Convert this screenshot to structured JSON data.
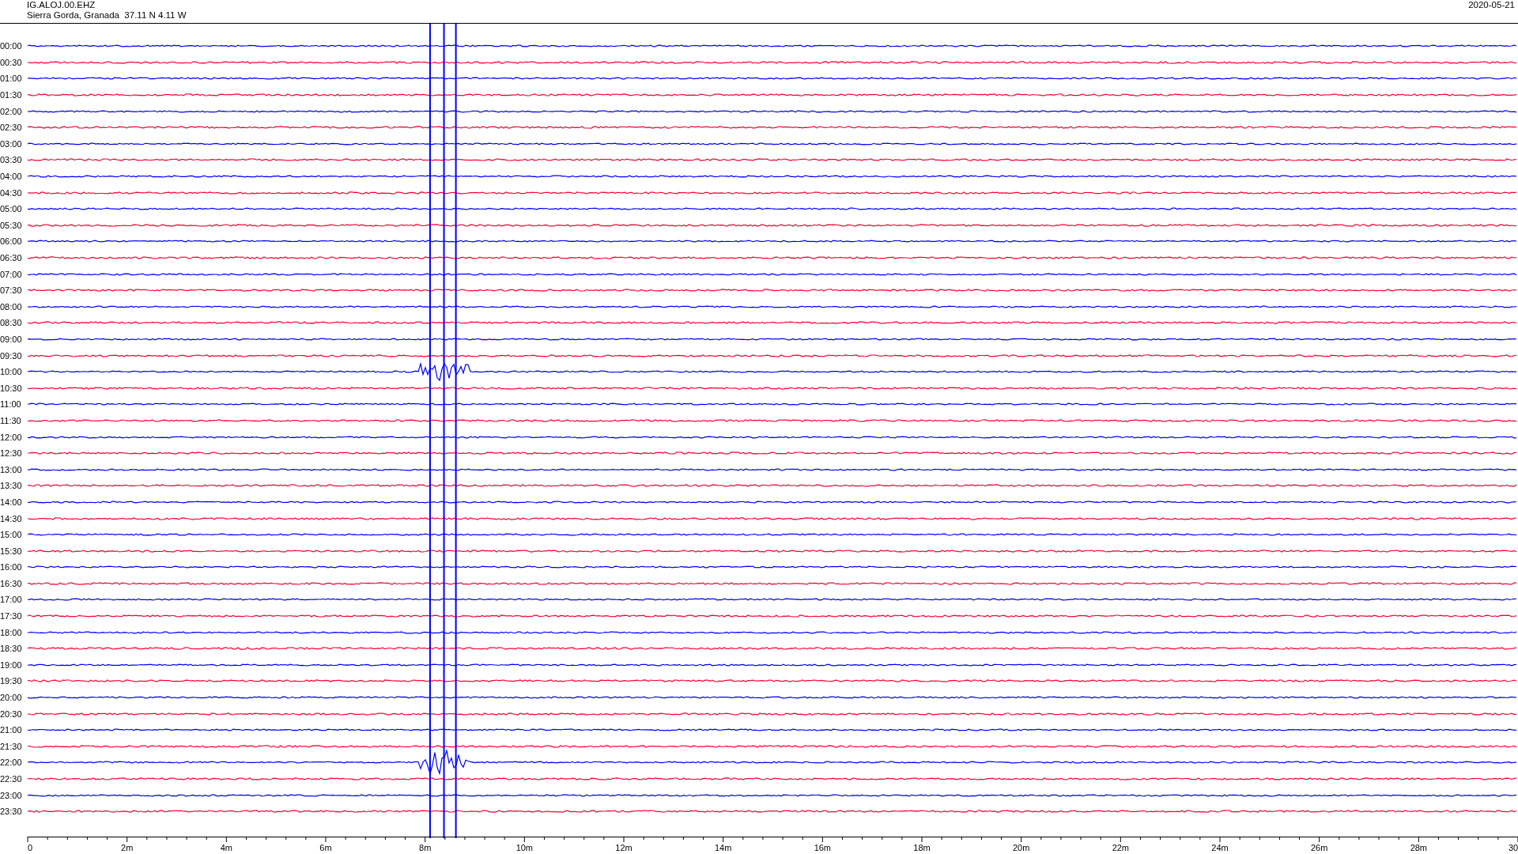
{
  "header": {
    "station": "IG.ALOJ.00.EHZ",
    "location": "Sierra Gorda, Granada  37.11 N 4.11 W",
    "date": "2020-05-21"
  },
  "rows": [
    {
      "time": "00:00",
      "color": "#0000ff"
    },
    {
      "time": "00:30",
      "color": "#ff0033"
    },
    {
      "time": "01:00",
      "color": "#0000ff"
    },
    {
      "time": "01:30",
      "color": "#ff0033"
    },
    {
      "time": "02:00",
      "color": "#0000ff"
    },
    {
      "time": "02:30",
      "color": "#ff0033"
    },
    {
      "time": "03:00",
      "color": "#0000ff"
    },
    {
      "time": "03:30",
      "color": "#ff0033"
    },
    {
      "time": "04:00",
      "color": "#0000ff"
    },
    {
      "time": "04:30",
      "color": "#ff0033"
    },
    {
      "time": "05:00",
      "color": "#0000ff"
    },
    {
      "time": "05:30",
      "color": "#ff0033"
    },
    {
      "time": "06:00",
      "color": "#0000ff"
    },
    {
      "time": "06:30",
      "color": "#ff0033"
    },
    {
      "time": "07:00",
      "color": "#0000ff"
    },
    {
      "time": "07:30",
      "color": "#ff0033"
    },
    {
      "time": "08:00",
      "color": "#0000ff"
    },
    {
      "time": "08:30",
      "color": "#ff0033"
    },
    {
      "time": "09:00",
      "color": "#0000ff"
    },
    {
      "time": "09:30",
      "color": "#ff0033"
    },
    {
      "time": "10:00",
      "color": "#0000ff"
    },
    {
      "time": "10:30",
      "color": "#ff0033"
    },
    {
      "time": "11:00",
      "color": "#0000ff"
    },
    {
      "time": "11:30",
      "color": "#ff0033"
    },
    {
      "time": "12:00",
      "color": "#0000ff"
    },
    {
      "time": "12:30",
      "color": "#ff0033"
    },
    {
      "time": "13:00",
      "color": "#0000ff"
    },
    {
      "time": "13:30",
      "color": "#ff0033"
    },
    {
      "time": "14:00",
      "color": "#0000ff"
    },
    {
      "time": "14:30",
      "color": "#ff0033"
    },
    {
      "time": "15:00",
      "color": "#0000ff"
    },
    {
      "time": "15:30",
      "color": "#ff0033"
    },
    {
      "time": "16:00",
      "color": "#0000ff"
    },
    {
      "time": "16:30",
      "color": "#ff0033"
    },
    {
      "time": "17:00",
      "color": "#0000ff"
    },
    {
      "time": "17:30",
      "color": "#ff0033"
    },
    {
      "time": "18:00",
      "color": "#0000ff"
    },
    {
      "time": "18:30",
      "color": "#ff0033"
    },
    {
      "time": "19:00",
      "color": "#0000ff"
    },
    {
      "time": "19:30",
      "color": "#ff0033"
    },
    {
      "time": "20:00",
      "color": "#0000ff"
    },
    {
      "time": "20:30",
      "color": "#ff0033"
    },
    {
      "time": "21:00",
      "color": "#0000ff"
    },
    {
      "time": "21:30",
      "color": "#ff0033"
    },
    {
      "time": "22:00",
      "color": "#0000ff"
    },
    {
      "time": "22:30",
      "color": "#ff0033"
    },
    {
      "time": "23:00",
      "color": "#0000ff"
    },
    {
      "time": "23:30",
      "color": "#ff0033"
    }
  ],
  "x_axis": {
    "labels": [
      "0",
      "2m",
      "4m",
      "6m",
      "8m",
      "10m",
      "12m",
      "14m",
      "16m",
      "18m",
      "20m",
      "22m",
      "24m",
      "26m",
      "28m",
      "30"
    ]
  }
}
